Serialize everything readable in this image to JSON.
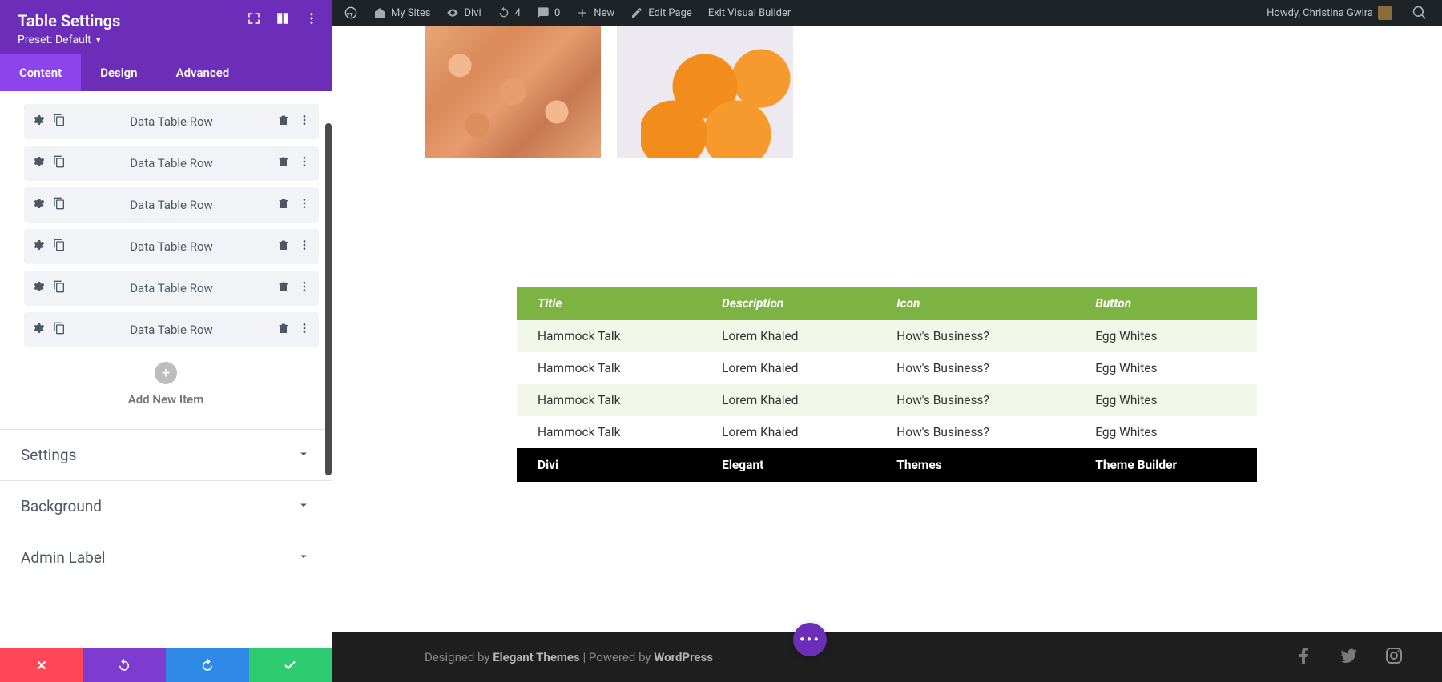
{
  "adminbar": {
    "my_sites": "My Sites",
    "site_name": "Divi",
    "updates": "4",
    "comments": "0",
    "new": "New",
    "edit_page": "Edit Page",
    "exit_builder": "Exit Visual Builder",
    "howdy": "Howdy, Christina Gwira"
  },
  "panel": {
    "title": "Table Settings",
    "preset_label": "Preset: Default",
    "tabs": {
      "content": "Content",
      "design": "Design",
      "advanced": "Advanced"
    },
    "row_label": "Data Table Row",
    "add_label": "Add New Item",
    "acc": {
      "settings": "Settings",
      "background": "Background",
      "admin_label": "Admin Label"
    }
  },
  "table": {
    "headers": [
      "Title",
      "Description",
      "Icon",
      "Button"
    ],
    "rows": [
      [
        "Hammock Talk",
        "Lorem Khaled",
        "How's Business?",
        "Egg Whites"
      ],
      [
        "Hammock Talk",
        "Lorem Khaled",
        "How's Business?",
        "Egg Whites"
      ],
      [
        "Hammock Talk",
        "Lorem Khaled",
        "How's Business?",
        "Egg Whites"
      ],
      [
        "Hammock Talk",
        "Lorem Khaled",
        "How's Business?",
        "Egg Whites"
      ]
    ],
    "footer": [
      "Divi",
      "Elegant",
      "Themes",
      "Theme Builder"
    ]
  },
  "footer": {
    "designed_by": "Designed by ",
    "theme": "Elegant Themes",
    "sep": " | Powered by ",
    "platform": "WordPress"
  }
}
